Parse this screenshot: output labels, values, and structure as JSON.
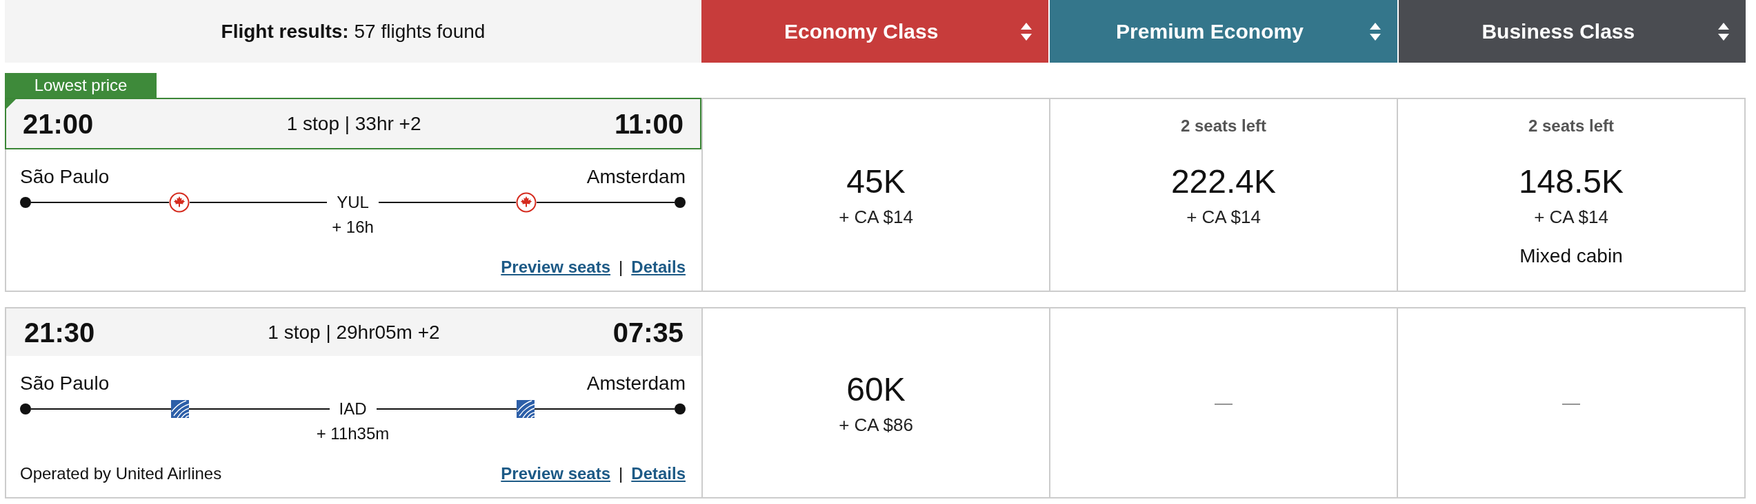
{
  "results_header": {
    "text": "**Flight results:** 57 flights found"
  },
  "cabins": [
    {
      "name": "Economy Class",
      "color": "#c73c3b"
    },
    {
      "name": "Premium Economy",
      "color": "#34768b"
    },
    {
      "name": "Business Class",
      "color": "#4a4c51"
    }
  ],
  "flights": [
    {
      "kind": "maple-leaf",
      "badge": "Lowest price",
      "highlighted": true,
      "departure_time": "21:00",
      "summary": "1 stop | 33hr +2",
      "arrival_time": "11:00",
      "origin": "São Paulo",
      "destination": "Amsterdam",
      "stop_code": "YUL",
      "layover": "+ 16h",
      "links": [
        "Preview seats",
        "Details"
      ],
      "link_separator": "|",
      "fares": [
        {
          "kind": "price",
          "points": "45K",
          "taxes": "+ CA $14"
        },
        {
          "kind": "price",
          "seats_left": "2 seats left",
          "points": "222.4K",
          "taxes": "+ CA $14"
        },
        {
          "kind": "price",
          "seats_left": "2 seats left",
          "points": "148.5K",
          "taxes": "+ CA $14",
          "note": "Mixed cabin"
        }
      ]
    },
    {
      "kind": "globe",
      "highlighted": false,
      "departure_time": "21:30",
      "summary": "1 stop | 29hr05m +2",
      "arrival_time": "07:35",
      "origin": "São Paulo",
      "destination": "Amsterdam",
      "stop_code": "IAD",
      "layover": "+ 11h35m",
      "operator": "Operated by United Airlines",
      "links": [
        "Preview seats",
        "Details"
      ],
      "link_separator": "|",
      "fares": [
        {
          "kind": "price",
          "points": "60K",
          "taxes": "+ CA $86"
        },
        {
          "kind": "unavailable",
          "text": "—"
        },
        {
          "kind": "unavailable",
          "text": "—"
        }
      ]
    }
  ]
}
